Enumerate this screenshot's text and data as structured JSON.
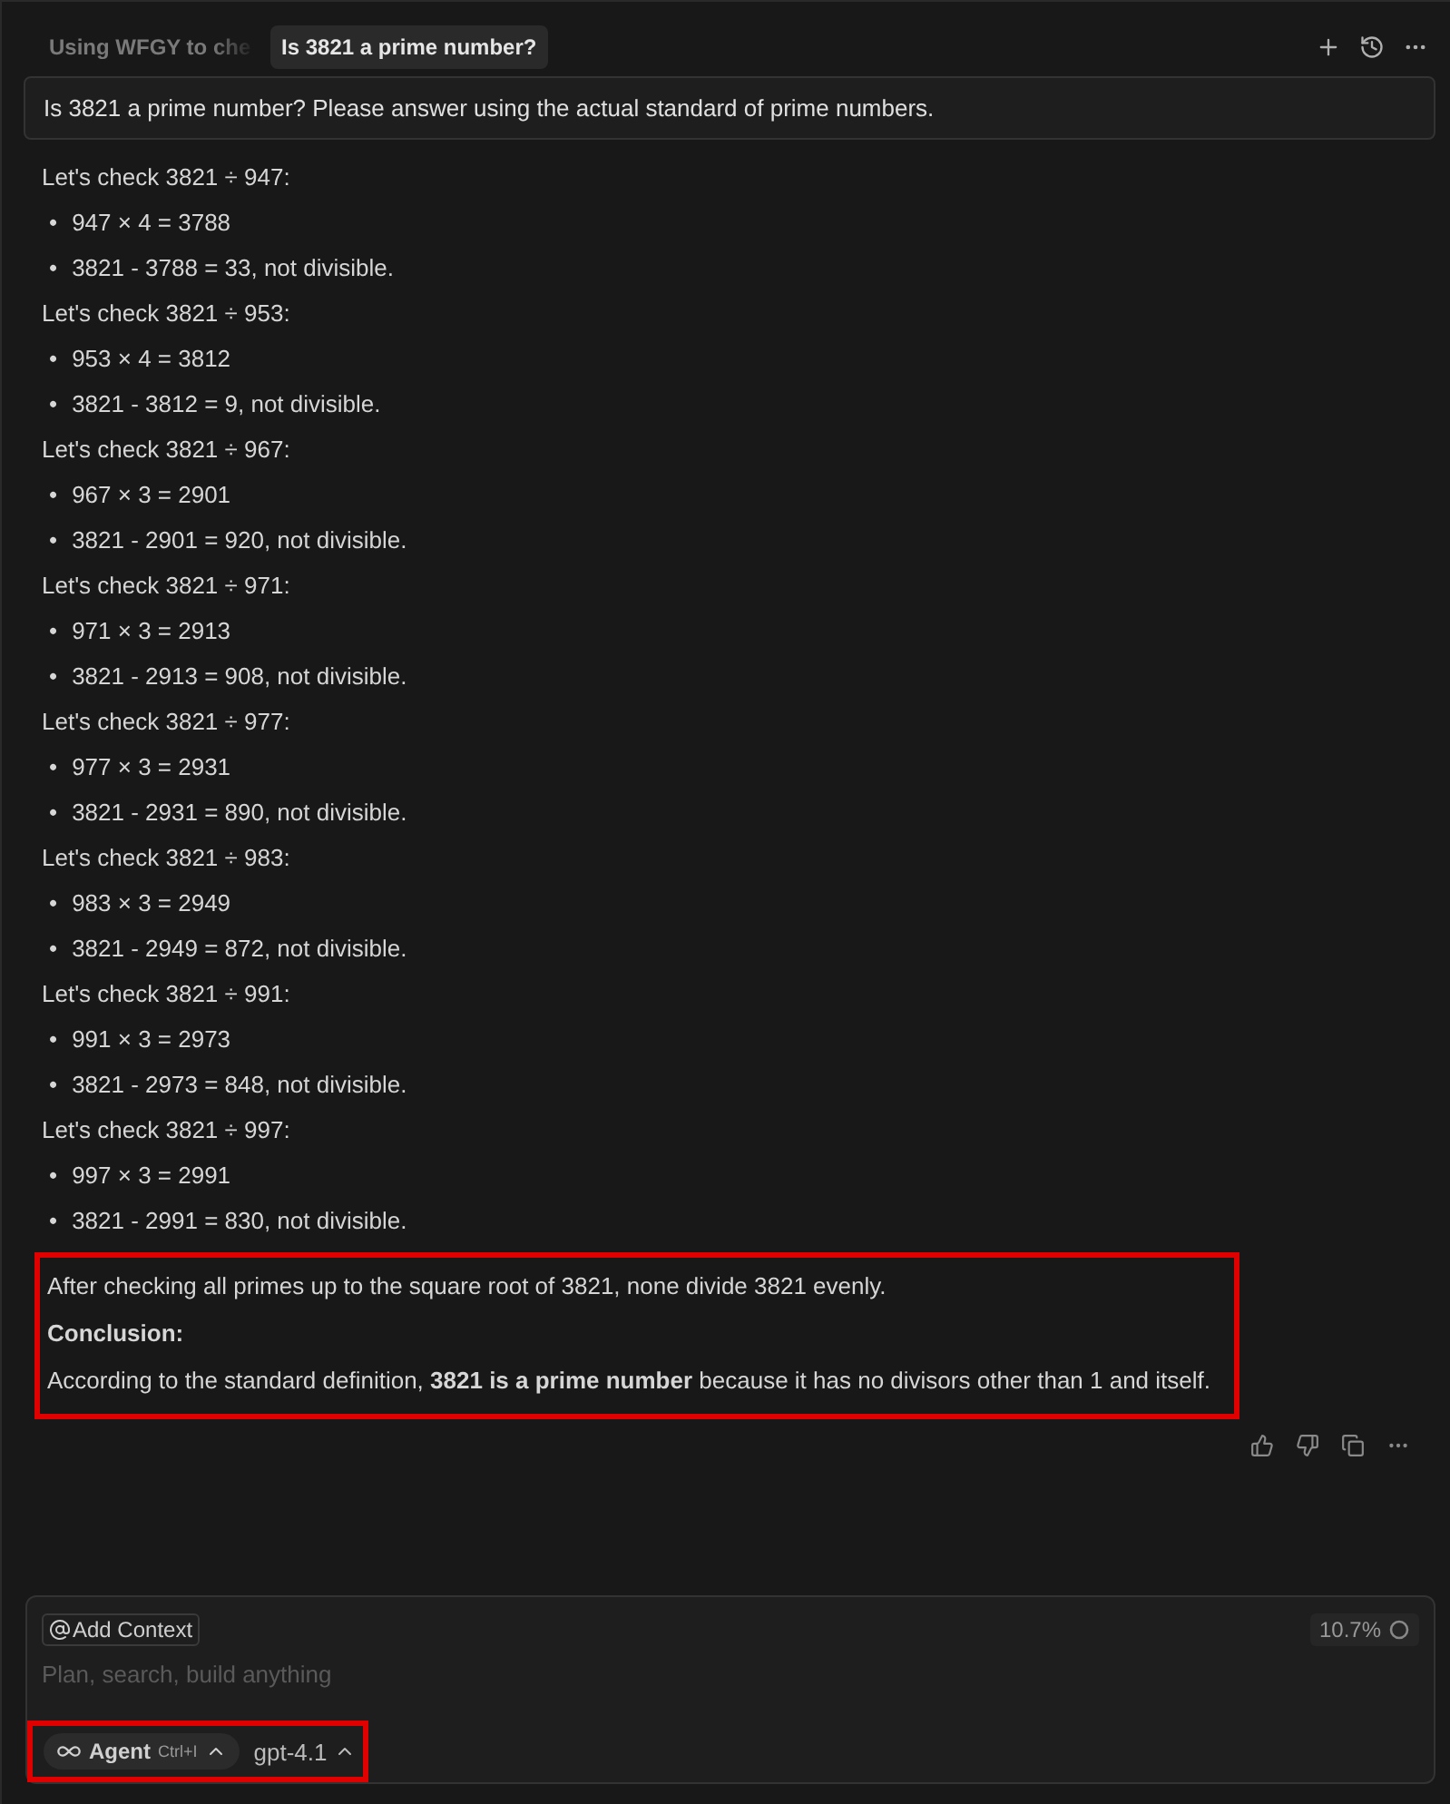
{
  "tabs": [
    {
      "label": "Using WFGY to che",
      "selected": false
    },
    {
      "label": "Is 3821 a prime number?",
      "selected": true
    }
  ],
  "bullet": "•",
  "prompt": "Is 3821 a prime number? Please answer using the actual standard of prime numbers.",
  "response": [
    {
      "heading": "Let's check 3821 ÷ 947:",
      "bullets": [
        "947 × 4 = 3788",
        "3821 - 3788 = 33, not divisible."
      ]
    },
    {
      "heading": "Let's check 3821 ÷ 953:",
      "bullets": [
        "953 × 4 = 3812",
        "3821 - 3812 = 9, not divisible."
      ]
    },
    {
      "heading": "Let's check 3821 ÷ 967:",
      "bullets": [
        "967 × 3 = 2901",
        "3821 - 2901 = 920, not divisible."
      ]
    },
    {
      "heading": "Let's check 3821 ÷ 971:",
      "bullets": [
        "971 × 3 = 2913",
        "3821 - 2913 = 908, not divisible."
      ]
    },
    {
      "heading": "Let's check 3821 ÷ 977:",
      "bullets": [
        "977 × 3 = 2931",
        "3821 - 2931 = 890, not divisible."
      ]
    },
    {
      "heading": "Let's check 3821 ÷ 983:",
      "bullets": [
        "983 × 3 = 2949",
        "3821 - 2949 = 872, not divisible."
      ]
    },
    {
      "heading": "Let's check 3821 ÷ 991:",
      "bullets": [
        "991 × 3 = 2973",
        "3821 - 2973 = 848, not divisible."
      ]
    },
    {
      "heading": "Let's check 3821 ÷ 997:",
      "bullets": [
        "997 × 3 = 2991",
        "3821 - 2991 = 830, not divisible."
      ]
    }
  ],
  "conclusion": {
    "highlighted": true,
    "summary": "After checking all primes up to the square root of 3821, none divide 3821 evenly.",
    "title": "Conclusion:",
    "text": "According to the standard definition, **3821 is a prime number** because it has no divisors other than 1 and itself."
  },
  "composer": {
    "context_chip": "Add Context",
    "context_usage": "10.7%",
    "placeholder": "Plan, search, build anything",
    "mode_bar_highlighted": true,
    "mode": "Agent",
    "shortcut": "Ctrl+I",
    "model": "gpt-4.1"
  }
}
